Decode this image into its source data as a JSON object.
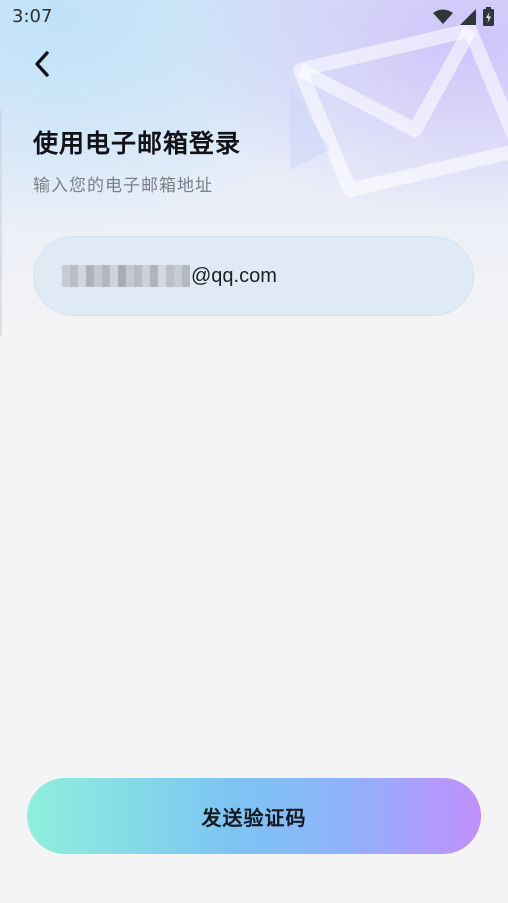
{
  "status_bar": {
    "time": "3:07",
    "icons": [
      "wifi-icon",
      "cellular-signal-icon",
      "battery-charging-icon"
    ]
  },
  "header": {
    "back_icon": "chevron-left-icon"
  },
  "main": {
    "title": "使用电子邮箱登录",
    "subtitle": "输入您的电子邮箱地址",
    "email_field": {
      "value_visible_suffix": "@qq.com",
      "value_prefix_obscured": true
    }
  },
  "footer": {
    "send_code_label": "发送验证码"
  },
  "colors": {
    "background": "#f4f4f5",
    "button_gradient_start": "#8ff0dc",
    "button_gradient_end": "#c18ffb",
    "title": "#111318",
    "subtitle": "#7b7f88"
  }
}
